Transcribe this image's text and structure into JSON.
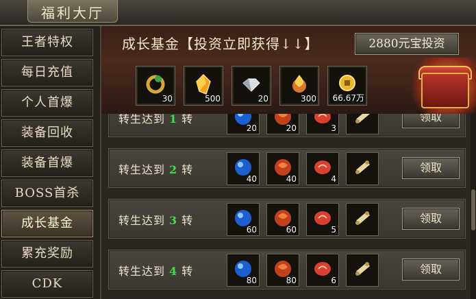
{
  "window": {
    "title": "福利大厅"
  },
  "sidebar": {
    "items": [
      {
        "label": "王者特权",
        "active": false
      },
      {
        "label": "每日充值",
        "active": false
      },
      {
        "label": "个人首爆",
        "active": false
      },
      {
        "label": "装备回收",
        "active": false
      },
      {
        "label": "装备首爆",
        "active": false
      },
      {
        "label": "BOSS首杀",
        "active": false
      },
      {
        "label": "成长基金",
        "active": true
      },
      {
        "label": "累充奖励",
        "active": false
      },
      {
        "label": "CDK",
        "active": false
      }
    ]
  },
  "header": {
    "title": "成长基金【投资立即获得↓↓】",
    "invest_button": "2880元宝投资",
    "rewards": [
      {
        "icon": "gold-dragon-ring-icon",
        "count": "30"
      },
      {
        "icon": "amber-crystal-icon",
        "count": "500"
      },
      {
        "icon": "diamond-icon",
        "count": "20"
      },
      {
        "icon": "golden-flame-orb-icon",
        "count": "300"
      },
      {
        "icon": "gold-coin-icon",
        "count": "66.67万"
      }
    ]
  },
  "rows": [
    {
      "prefix": "转生达到",
      "level": "1",
      "suffix": "转",
      "items": [
        "20",
        "20",
        "3",
        ""
      ],
      "button": "领取"
    },
    {
      "prefix": "转生达到",
      "level": "2",
      "suffix": "转",
      "items": [
        "40",
        "40",
        "4",
        ""
      ],
      "button": "领取"
    },
    {
      "prefix": "转生达到",
      "level": "3",
      "suffix": "转",
      "items": [
        "60",
        "60",
        "5",
        ""
      ],
      "button": "领取"
    },
    {
      "prefix": "转生达到",
      "level": "4",
      "suffix": "转",
      "items": [
        "80",
        "80",
        "6",
        ""
      ],
      "button": "领取"
    }
  ],
  "row_item_icons": [
    "blue-orb-icon",
    "red-orb-icon",
    "red-talisman-icon",
    "scroll-icon"
  ],
  "colors": {
    "level_number": "#3ee04a",
    "accent_gold": "#e2b04a"
  }
}
